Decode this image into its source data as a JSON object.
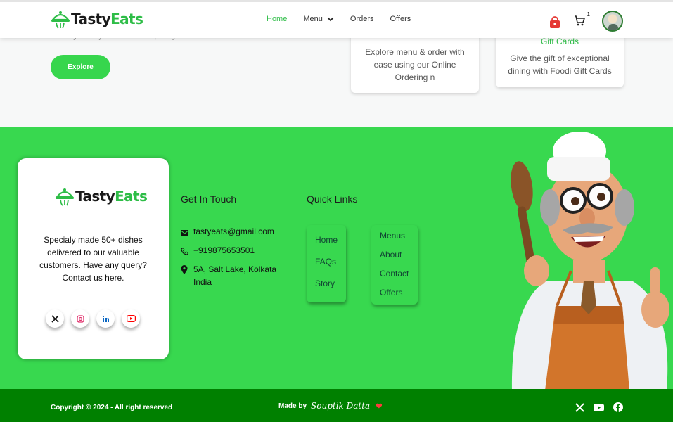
{
  "nav": {
    "logo_a": "Tasty",
    "logo_b": "Eats",
    "links": [
      "Home",
      "Menu",
      "Orders",
      "Offers"
    ],
    "active_link": "Home",
    "cart_count": "1",
    "icons": [
      "shopping-bag-icon",
      "cart-icon",
      "chevron-down-icon"
    ]
  },
  "hero": {
    "text_fragment": "culinary artistry with warm hospitality.",
    "explore_label": "Explore"
  },
  "cards": [
    {
      "title": "",
      "description": "Explore menu & order with ease using our Online Ordering n"
    },
    {
      "title": "Gift Cards",
      "description": "Give the gift of exceptional dining with Foodi Gift Cards"
    }
  ],
  "footer": {
    "brand_a": "Tasty",
    "brand_b": "Eats",
    "description": "Specialy made 50+ dishes delivered to our valuable customers. Have any query? Contact us here.",
    "socials": [
      "x-icon",
      "instagram-icon",
      "linkedin-icon",
      "youtube-icon"
    ],
    "touch_heading": "Get In Touch",
    "email": "tastyeats@gmail.com",
    "phone": "+919875653501",
    "address": "5A, Salt Lake, Kolkata India",
    "quick_links_heading": "Quick Links",
    "quick_links_a": [
      "Home",
      "FAQs",
      "Story"
    ],
    "quick_links_b": [
      "Menus",
      "About",
      "Contact",
      "Offers"
    ]
  },
  "bottom": {
    "copyright": "Copyright © 2024 - All right reserved",
    "made_by": "Made by",
    "author": "Souptik Datta",
    "icons": [
      "x-icon",
      "youtube-icon",
      "facebook-icon"
    ]
  },
  "colors": {
    "brand_green": "#37d64d",
    "footer_green": "#38d84f",
    "bottom_green": "#008000",
    "accent_red": "#e53935"
  }
}
